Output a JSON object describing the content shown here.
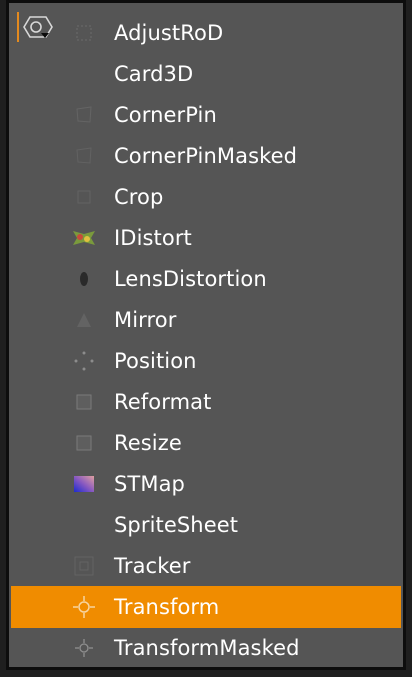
{
  "menu": {
    "icon": "transform-category-icon",
    "items": [
      {
        "label": "AdjustRoD",
        "icon": "adjustrod-icon"
      },
      {
        "label": "Card3D",
        "icon": "card3d-icon"
      },
      {
        "label": "CornerPin",
        "icon": "cornerpin-icon"
      },
      {
        "label": "CornerPinMasked",
        "icon": "cornerpinmasked-icon"
      },
      {
        "label": "Crop",
        "icon": "crop-icon"
      },
      {
        "label": "IDistort",
        "icon": "idistort-icon"
      },
      {
        "label": "LensDistortion",
        "icon": "lensdistortion-icon"
      },
      {
        "label": "Mirror",
        "icon": "mirror-icon"
      },
      {
        "label": "Position",
        "icon": "position-icon"
      },
      {
        "label": "Reformat",
        "icon": "reformat-icon"
      },
      {
        "label": "Resize",
        "icon": "resize-icon"
      },
      {
        "label": "STMap",
        "icon": "stmap-icon"
      },
      {
        "label": "SpriteSheet",
        "icon": "spritesheet-icon"
      },
      {
        "label": "Tracker",
        "icon": "tracker-icon"
      },
      {
        "label": "Transform",
        "icon": "transform-icon"
      },
      {
        "label": "TransformMasked",
        "icon": "transformmasked-icon"
      }
    ],
    "highlighted_item": "Transform"
  },
  "colors": {
    "menu_background": "#555555",
    "highlight": "#f08c00",
    "text": "#ffffff",
    "border": "#0d0d0d"
  }
}
